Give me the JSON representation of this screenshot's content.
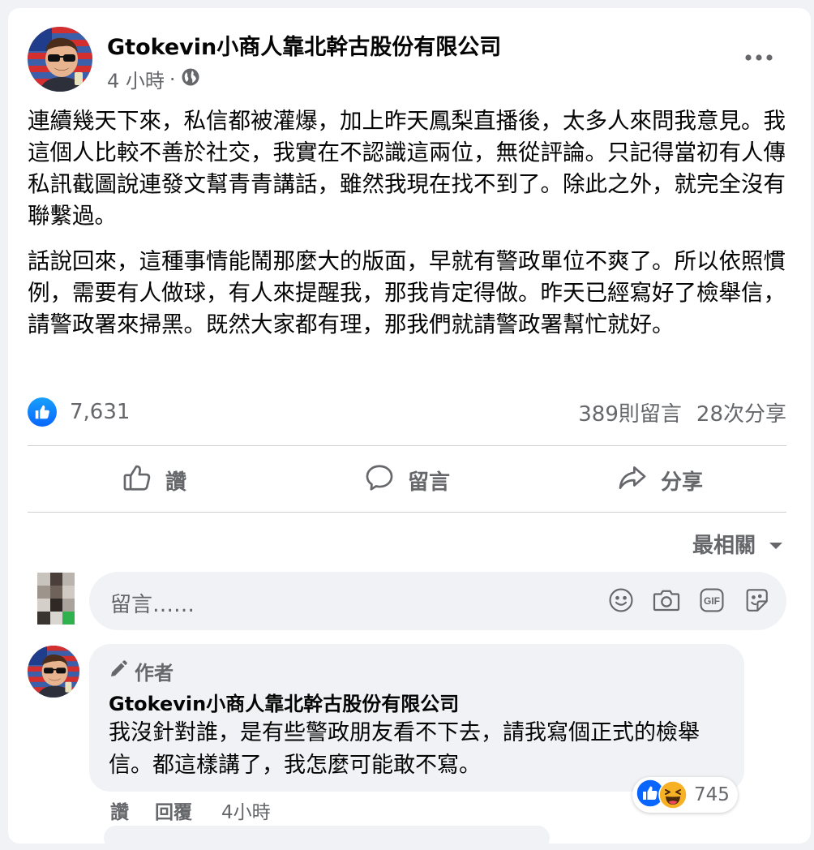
{
  "post": {
    "author": "Gtokevin小商人靠北幹古股份有限公司",
    "time": "4 小時",
    "separator": "·",
    "paragraph1": "連續幾天下來，私信都被灌爆，加上昨天鳳梨直播後，太多人來問我意見。我這個人比較不善於社交，我實在不認識這兩位，無從評論。只記得當初有人傳私訊截圖說連發文幫青青講話，雖然我現在找不到了。除此之外，就完全沒有聯繫過。",
    "paragraph2": "話說回來，這種事情能鬧那麼大的版面，早就有警政單位不爽了。所以依照慣例，需要有人做球，有人來提醒我，那我肯定得做。昨天已經寫好了檢舉信，請警政署來掃黑。既然大家都有理，那我們就請警政署幫忙就好。",
    "reaction_count": "7,631",
    "comment_count": "389則留言",
    "share_count": "28次分享"
  },
  "actions": {
    "like": "讚",
    "comment": "留言",
    "share": "分享"
  },
  "sort": {
    "label": "最相關"
  },
  "composer": {
    "placeholder": "留言……"
  },
  "comment": {
    "badge": "作者",
    "author": "Gtokevin小商人靠北幹古股份有限公司",
    "text": "我沒針對誰，是有些警政朋友看不下去，請我寫個正式的檢舉信。都這樣講了，我怎麼可能敢不寫。",
    "reaction_count": "745",
    "like_action": "讚",
    "reply_action": "回覆",
    "time": "4小時"
  },
  "icons": {
    "globe": "globe-icon",
    "more": "more-horizontal-icon",
    "like_reaction": "like-reaction-icon",
    "haha_reaction": "haha-reaction-icon",
    "thumbs_up": "thumbs-up-icon",
    "speech_bubble": "comment-icon",
    "share_arrow": "share-icon",
    "caret": "caret-down-icon",
    "emoji": "emoji-icon",
    "camera": "camera-icon",
    "gif": "gif-icon",
    "sticker": "sticker-icon",
    "pencil": "pencil-icon"
  },
  "colors": {
    "accent": "#0866ff",
    "secondary_text": "#65676b",
    "surface": "#f0f2f5"
  }
}
